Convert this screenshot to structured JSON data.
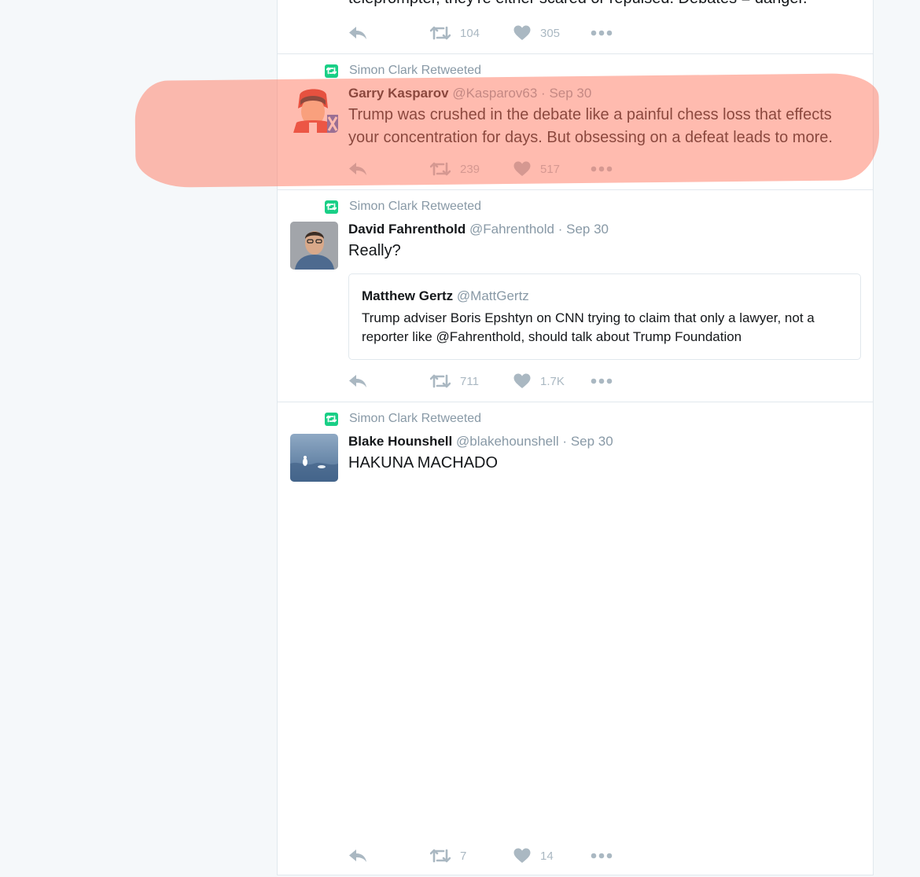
{
  "colors": {
    "retweet_green": "#19cf86",
    "muted": "#8899a6",
    "action_gray": "#aab8c2",
    "highlight": "#ff785f"
  },
  "tweets": [
    {
      "text": "teleprompter, they're either scared or repulsed. Debates = danger.",
      "retweets": "104",
      "likes": "305"
    },
    {
      "context": "Simon Clark Retweeted",
      "name": "Garry Kasparov",
      "handle": "@Kasparov63",
      "sep": "·",
      "time": "Sep 30",
      "text": "Trump was crushed in the debate like a painful chess loss that effects your concentration for days. But obsessing on a defeat leads to more.",
      "retweets": "239",
      "likes": "517"
    },
    {
      "context": "Simon Clark Retweeted",
      "name": "David Fahrenthold",
      "handle": "@Fahrenthold",
      "sep": "·",
      "time": "Sep 30",
      "text": "Really?",
      "quote": {
        "name": "Matthew Gertz",
        "handle": "@MattGertz",
        "text": "Trump adviser Boris Epshtyn on CNN trying to claim that only a lawyer, not a reporter like @Fahrenthold, should talk about Trump Foundation"
      },
      "retweets": "711",
      "likes": "1.7K"
    },
    {
      "context": "Simon Clark Retweeted",
      "name": "Blake Hounshell",
      "handle": "@blakehounshell",
      "sep": "·",
      "time": "Sep 30",
      "text": "HAKUNA MACHADO",
      "retweets": "7",
      "likes": "14"
    }
  ]
}
